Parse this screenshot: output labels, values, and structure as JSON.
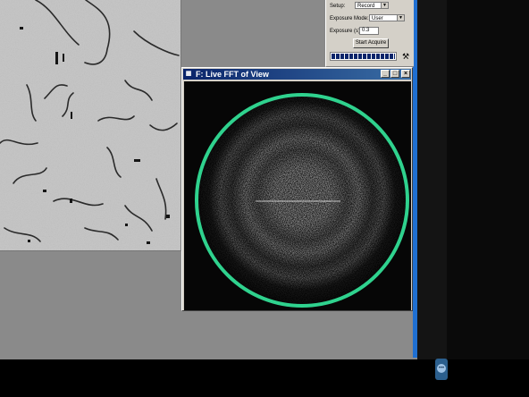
{
  "panel": {
    "setup_label": "Setup:",
    "setup_value": "Record",
    "exposure_mode_label": "Exposure Mode:",
    "exposure_mode_value": "User",
    "exposure_label": "Exposure (s):",
    "exposure_value": "0.3",
    "start_button": "Start Acquire",
    "progress": 1.0
  },
  "fft_window": {
    "title": "F: Live FFT of View",
    "minimize": "_",
    "maximize": "□",
    "close": "×",
    "ring_color": "#2fd28e"
  },
  "icons": {
    "app": "window-app-icon",
    "tool": "hammer-icon",
    "dropdown": "chevron-down-icon",
    "tray": "chat-icon"
  }
}
